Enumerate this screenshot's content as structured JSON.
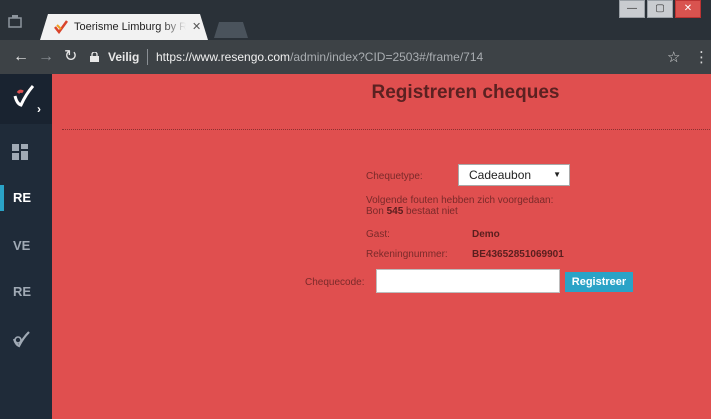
{
  "browser": {
    "tab_title": "Toerisme Limburg by Resengo",
    "tab_close": "✕",
    "window_controls": [
      "—",
      "▢",
      "✕"
    ],
    "secure_label": "Veilig",
    "url_host": "https://www.resengo.com",
    "url_path": "/admin/index?CID=2503#/frame/714",
    "icons": [
      "back-icon",
      "forward-icon",
      "reload-icon",
      "lock-icon",
      "star-icon",
      "menu-icon"
    ]
  },
  "sidebar": {
    "items": [
      {
        "label": "RE",
        "active": true
      },
      {
        "label": "VE",
        "active": false
      },
      {
        "label": "RE",
        "active": false
      }
    ],
    "accent": "#2aa3c7"
  },
  "main": {
    "title": "Registreren cheques",
    "chequetype_label": "Chequetype:",
    "chequetype_value": "Cadeaubon",
    "error_line1": "Volgende fouten hebben zich voorgedaan:",
    "error_prefix": "Bon",
    "error_number": "545",
    "error_suffix": "bestaat niet",
    "guest_label": "Gast:",
    "guest_value": "Demo",
    "account_label": "Rekeningnummer:",
    "account_value": "BE43652851069901",
    "code_label": "Chequecode:",
    "code_value": "",
    "register_button": "Registreer",
    "background": "#e04f4f"
  }
}
